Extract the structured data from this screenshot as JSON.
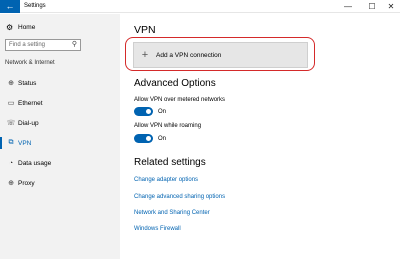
{
  "window": {
    "title": "Settings",
    "back_glyph": "←",
    "min_glyph": "—",
    "max_glyph": "☐",
    "close_glyph": "✕"
  },
  "sidebar": {
    "home": {
      "label": "Home",
      "icon": "gear-icon"
    },
    "search": {
      "placeholder": "Find a setting",
      "icon": "search-icon"
    },
    "section": "Network & Internet",
    "items": [
      {
        "label": "Status",
        "icon": "globe-icon",
        "glyph": "⊕"
      },
      {
        "label": "Ethernet",
        "icon": "ethernet-icon",
        "glyph": "▭"
      },
      {
        "label": "Dial-up",
        "icon": "phone-icon",
        "glyph": "☏"
      },
      {
        "label": "VPN",
        "icon": "vpn-icon",
        "glyph": "⧉",
        "active": true
      },
      {
        "label": "Data usage",
        "icon": "data-usage-icon",
        "glyph": "◔"
      },
      {
        "label": "Proxy",
        "icon": "globe-icon",
        "glyph": "⊕"
      }
    ]
  },
  "main": {
    "vpn_heading": "VPN",
    "add_vpn": {
      "plus": "+",
      "label": "Add a VPN connection"
    },
    "advanced_heading": "Advanced Options",
    "options": [
      {
        "label": "Allow VPN over metered networks",
        "state": "On"
      },
      {
        "label": "Allow VPN while roaming",
        "state": "On"
      }
    ],
    "related_heading": "Related settings",
    "links": [
      "Change adapter options",
      "Change advanced sharing options",
      "Network and Sharing Center",
      "Windows Firewall"
    ]
  },
  "colors": {
    "accent": "#0063b1",
    "highlight_ring": "#d42a2a",
    "sidebar_bg": "#f2f2f2"
  }
}
